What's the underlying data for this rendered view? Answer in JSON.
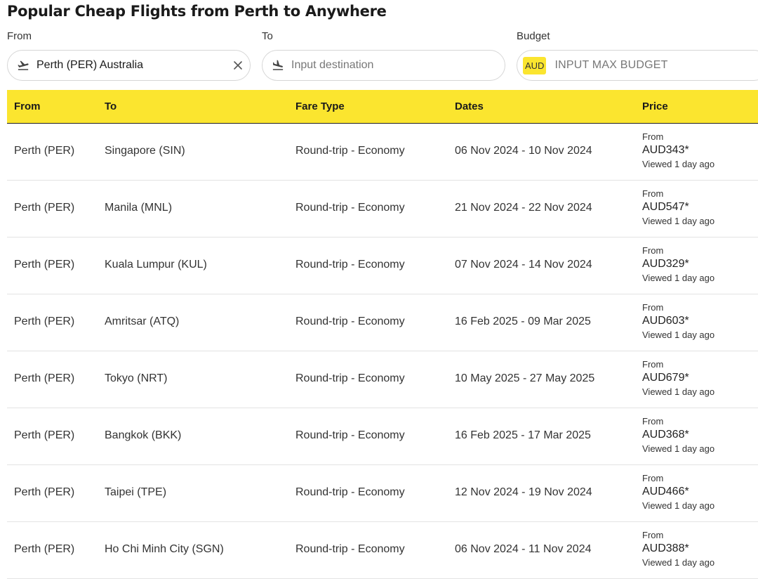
{
  "title": "Popular Cheap Flights from Perth to Anywhere",
  "search": {
    "from_label": "From",
    "from_value": "Perth (PER) Australia",
    "to_label": "To",
    "to_placeholder": "Input destination",
    "budget_label": "Budget",
    "currency": "AUD",
    "budget_placeholder": "INPUT MAX BUDGET"
  },
  "table": {
    "headers": [
      "From",
      "To",
      "Fare Type",
      "Dates",
      "Price"
    ],
    "rows": [
      {
        "from": "Perth (PER)",
        "to": "Singapore (SIN)",
        "fare": "Round-trip - Economy",
        "dates": "06 Nov 2024 - 10 Nov 2024",
        "price_from": "From",
        "price": "AUD343*",
        "viewed": "Viewed 1 day ago"
      },
      {
        "from": "Perth (PER)",
        "to": "Manila (MNL)",
        "fare": "Round-trip - Economy",
        "dates": "21 Nov 2024 - 22 Nov 2024",
        "price_from": "From",
        "price": "AUD547*",
        "viewed": "Viewed 1 day ago"
      },
      {
        "from": "Perth (PER)",
        "to": "Kuala Lumpur (KUL)",
        "fare": "Round-trip - Economy",
        "dates": "07 Nov 2024 - 14 Nov 2024",
        "price_from": "From",
        "price": "AUD329*",
        "viewed": "Viewed 1 day ago"
      },
      {
        "from": "Perth (PER)",
        "to": "Amritsar (ATQ)",
        "fare": "Round-trip - Economy",
        "dates": "16 Feb 2025 - 09 Mar 2025",
        "price_from": "From",
        "price": "AUD603*",
        "viewed": "Viewed 1 day ago"
      },
      {
        "from": "Perth (PER)",
        "to": "Tokyo (NRT)",
        "fare": "Round-trip - Economy",
        "dates": "10 May 2025 - 27 May 2025",
        "price_from": "From",
        "price": "AUD679*",
        "viewed": "Viewed 1 day ago"
      },
      {
        "from": "Perth (PER)",
        "to": "Bangkok (BKK)",
        "fare": "Round-trip - Economy",
        "dates": "16 Feb 2025 - 17 Mar 2025",
        "price_from": "From",
        "price": "AUD368*",
        "viewed": "Viewed 1 day ago"
      },
      {
        "from": "Perth (PER)",
        "to": "Taipei (TPE)",
        "fare": "Round-trip - Economy",
        "dates": "12 Nov 2024 - 19 Nov 2024",
        "price_from": "From",
        "price": "AUD466*",
        "viewed": "Viewed 1 day ago"
      },
      {
        "from": "Perth (PER)",
        "to": "Ho Chi Minh City (SGN)",
        "fare": "Round-trip - Economy",
        "dates": "06 Nov 2024 - 11 Nov 2024",
        "price_from": "From",
        "price": "AUD388*",
        "viewed": "Viewed 1 day ago"
      }
    ]
  },
  "icons": {
    "departure": "plane-departure-icon",
    "arrival": "plane-arrival-icon",
    "clear": "close-icon"
  },
  "colors": {
    "accent": "#fbe52f"
  }
}
